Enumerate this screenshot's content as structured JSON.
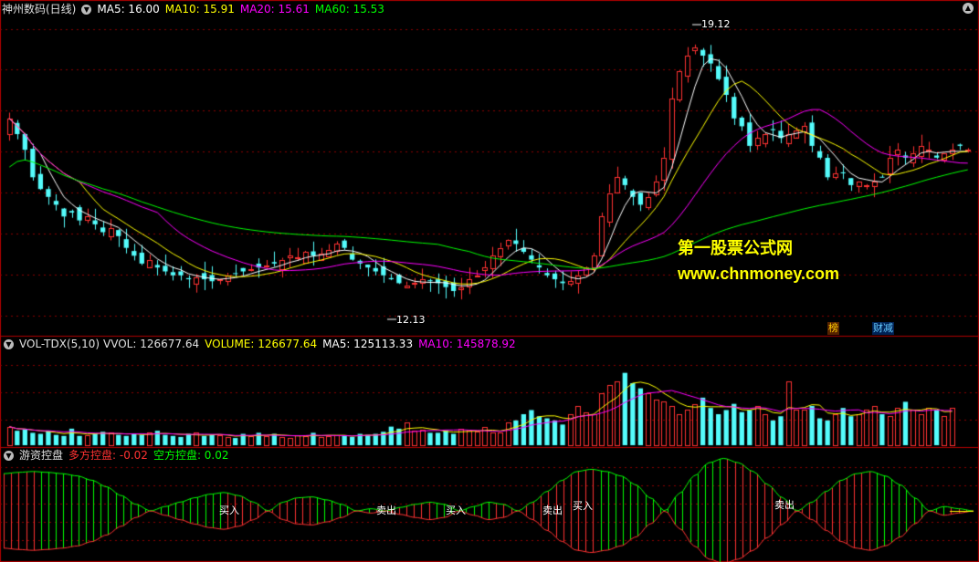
{
  "main_header": {
    "stock_name": "神州数码(日线)",
    "ma5": "MA5: 16.00",
    "ma10": "MA10: 15.91",
    "ma20": "MA20: 15.61",
    "ma60": "MA60: 15.53"
  },
  "price_annotations": {
    "high": "19.12",
    "low": "12.13"
  },
  "watermark": {
    "line1": "第一股票公式网",
    "line2": "www.chnmoney.com"
  },
  "event_badges": {
    "badge1": "榜",
    "badge2": "财减"
  },
  "volume_header": {
    "indicator": "VOL-TDX(5,10)",
    "vvol": "VVOL: 126677.64",
    "volume": "VOLUME: 126677.64",
    "ma5": "MA5: 125113.33",
    "ma10": "MA10: 145878.92"
  },
  "indicator_header": {
    "name": "游资控盘",
    "long": "多方控盘: -0.02",
    "short": "空方控盘: 0.02"
  },
  "signals": [
    {
      "text": "买入"
    },
    {
      "text": "卖出"
    },
    {
      "text": "买入"
    },
    {
      "text": "卖出"
    },
    {
      "text": "买入"
    },
    {
      "text": "卖出"
    }
  ],
  "colors": {
    "up": "#ff3232",
    "down": "#54fcfc",
    "ma5": "#ffffff",
    "ma10": "#ffff00",
    "ma20": "#ff00ff",
    "ma60": "#00ff00",
    "grid": "#8b0000",
    "border": "#b00000"
  },
  "chart_data": {
    "type": "candlestick",
    "y_range": [
      11.6,
      19.6
    ],
    "closes": [
      17.0,
      16.6,
      16.2,
      15.5,
      15.2,
      15.0,
      14.8,
      14.5,
      14.6,
      14.4,
      14.5,
      14.3,
      14.1,
      14.2,
      14.0,
      13.7,
      13.5,
      13.3,
      13.4,
      13.2,
      13.1,
      13.0,
      13.0,
      12.9,
      12.95,
      12.9,
      12.85,
      12.9,
      13.0,
      13.05,
      13.1,
      13.15,
      13.2,
      13.25,
      13.3,
      13.4,
      13.5,
      13.45,
      13.6,
      13.5,
      13.55,
      13.65,
      13.8,
      13.7,
      13.4,
      13.3,
      13.2,
      13.1,
      13.0,
      12.9,
      12.8,
      12.75,
      12.8,
      12.9,
      12.85,
      12.8,
      12.7,
      12.6,
      12.7,
      12.9,
      13.0,
      13.2,
      13.5,
      13.7,
      13.9,
      13.8,
      13.6,
      13.4,
      13.2,
      13.0,
      12.9,
      12.8,
      12.85,
      13.0,
      13.2,
      13.5,
      14.5,
      15.1,
      15.5,
      15.3,
      15.0,
      14.8,
      15.0,
      15.4,
      16.0,
      17.5,
      18.2,
      18.6,
      18.8,
      18.6,
      18.4,
      18.0,
      17.6,
      17.0,
      16.8,
      16.3,
      16.5,
      16.6,
      16.7,
      16.5,
      16.6,
      16.7,
      16.8,
      16.3,
      16.0,
      15.5,
      15.6,
      15.6,
      15.3,
      15.4,
      15.3,
      15.4,
      15.5,
      16.0,
      16.2,
      16.0,
      16.1,
      16.3,
      16.2,
      16.0,
      16.1,
      16.2,
      16.3,
      16.2
    ],
    "annotations": [
      "19.12",
      "12.13"
    ],
    "volume": [
      18,
      14,
      15,
      12,
      11,
      14,
      10,
      9,
      16,
      9,
      10,
      11,
      13,
      12,
      10,
      9,
      11,
      10,
      12,
      14,
      10,
      9,
      8,
      11,
      12,
      9,
      10,
      10,
      8,
      7,
      11,
      9,
      12,
      9,
      11,
      8,
      7,
      10,
      9,
      12,
      8,
      9,
      10,
      9,
      8,
      11,
      10,
      11,
      13,
      18,
      16,
      22,
      14,
      15,
      12,
      12,
      14,
      11,
      16,
      14,
      13,
      18,
      12,
      12,
      22,
      24,
      30,
      34,
      28,
      26,
      24,
      20,
      30,
      38,
      32,
      30,
      50,
      58,
      62,
      70,
      60,
      55,
      50,
      44,
      42,
      38,
      30,
      34,
      40,
      46,
      36,
      30,
      34,
      40,
      32,
      34,
      38,
      30,
      24,
      28,
      62,
      34,
      34,
      38,
      26,
      24,
      30,
      36,
      28,
      30,
      34,
      38,
      30,
      28,
      36,
      42,
      34,
      30,
      36,
      34,
      28,
      36
    ],
    "volume_max": 90,
    "oscillator": [
      0.85,
      0.88,
      0.9,
      0.88,
      0.85,
      0.8,
      0.7,
      0.55,
      0.35,
      0.15,
      0.0,
      -0.1,
      -0.2,
      -0.3,
      -0.38,
      -0.42,
      -0.35,
      -0.2,
      0.0,
      0.2,
      0.3,
      0.32,
      0.25,
      0.15,
      0.0,
      -0.05,
      0.0,
      0.08,
      0.15,
      0.2,
      0.15,
      0.0,
      -0.1,
      -0.2,
      -0.15,
      0.0,
      0.2,
      0.45,
      0.7,
      0.9,
      0.95,
      0.9,
      0.8,
      0.6,
      0.3,
      0.0,
      -0.4,
      -0.8,
      -1.1,
      -1.2,
      -1.1,
      -0.9,
      -0.6,
      -0.3,
      0.0,
      0.2,
      0.45,
      0.7,
      0.85,
      0.9,
      0.8,
      0.6,
      0.3,
      0.0,
      -0.1,
      -0.05,
      0.0
    ]
  }
}
